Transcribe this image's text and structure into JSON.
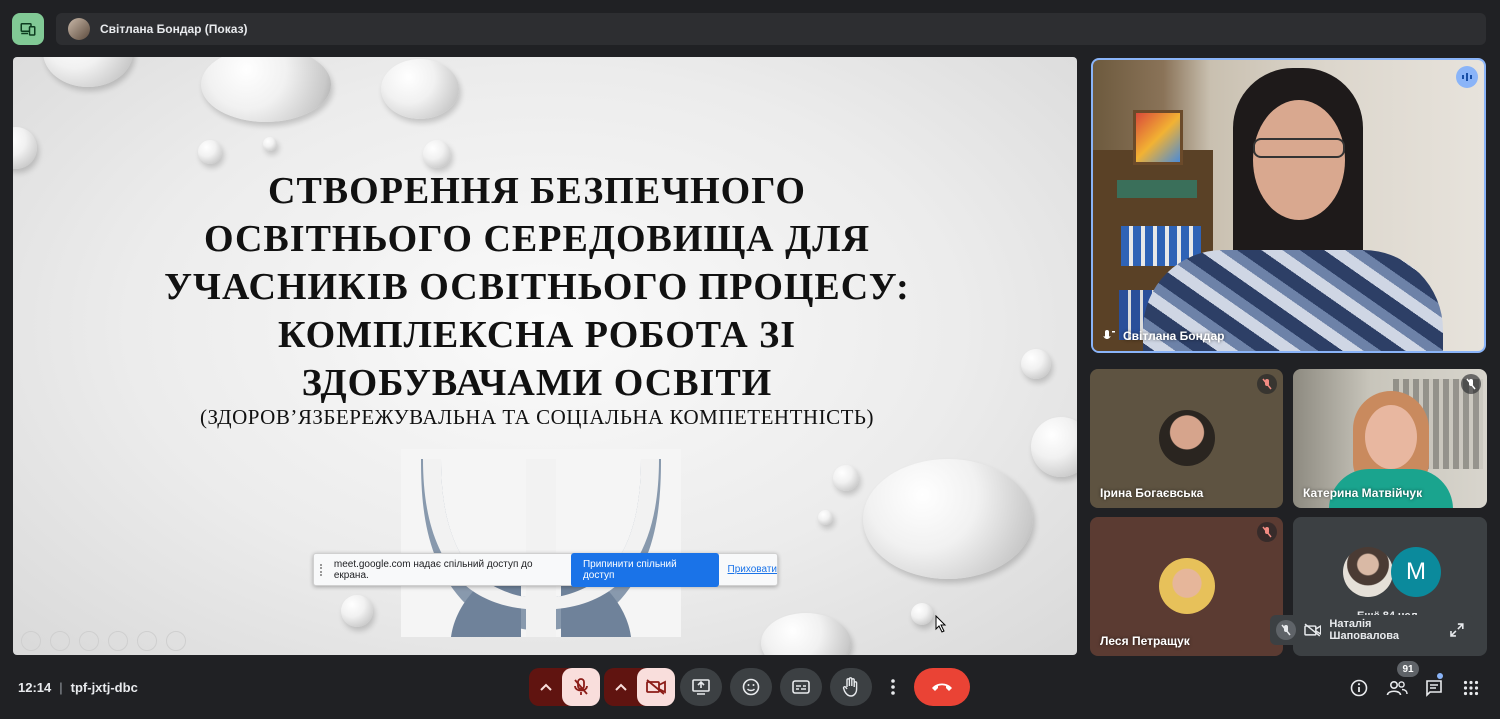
{
  "topbar": {
    "presenter_label": "Світлана Бондар (Показ)",
    "app_icon": "devices-icon"
  },
  "slide": {
    "title": "СТВОРЕННЯ БЕЗПЕЧНОГО ОСВІТНЬОГО СЕРЕДОВИЩА ДЛЯ УЧАСНИКІВ ОСВІТНЬОГО ПРОЦЕСУ: КОМПЛЕКСНА РОБОТА ЗІ ЗДОБУВАЧАМИ ОСВІТИ",
    "subtitle": "(ЗДОРОВ’ЯЗБЕРЕЖУВАЛЬНА ТА СОЦІАЛЬНА КОМПЕТЕНТНІСТЬ)"
  },
  "share_banner": {
    "message": "meet.google.com надає спільний доступ до екрана.",
    "stop_label": "Припинити спільний доступ",
    "hide_label": "Приховати"
  },
  "participants": {
    "presenter": {
      "name": "Світлана Бондар"
    },
    "tile1": {
      "name": "Ірина Богаєвська"
    },
    "tile2": {
      "name": "Катерина Матвійчук"
    },
    "tile3": {
      "name": "Леся Петращук"
    },
    "tile4": {
      "name": "Наталія Шаповалова",
      "avatar_letter": "M",
      "partial_text": "Ещё 84 чел"
    }
  },
  "bottombar": {
    "time": "12:14",
    "meeting_code": "tpf-jxtj-dbc",
    "participants_count": "91"
  },
  "colors": {
    "background": "#202124",
    "control": "#3c4043",
    "muted_control": "#f9dedc",
    "muted_icon": "#8c1d18",
    "end_call": "#ea4335",
    "accent": "#1a73e8",
    "avatar_teal": "#0b8a9c"
  }
}
